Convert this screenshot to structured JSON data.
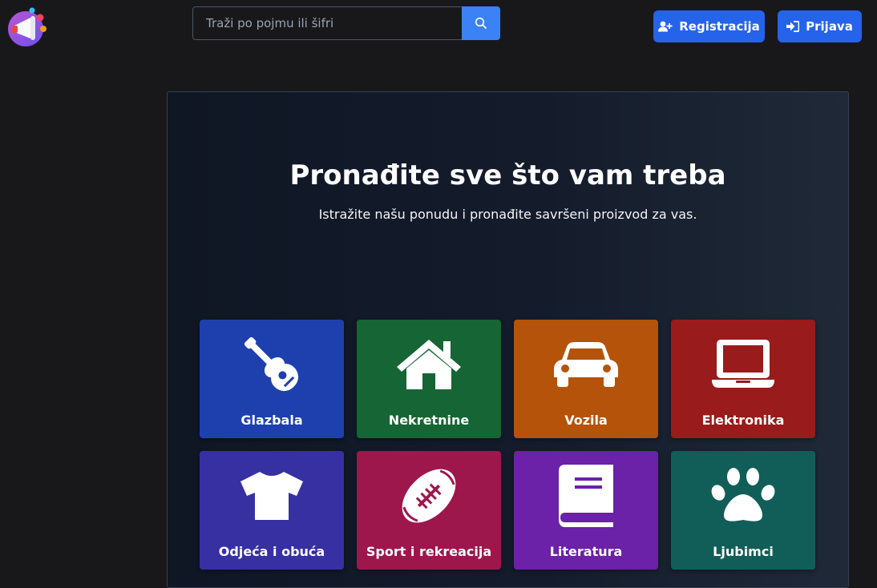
{
  "header": {
    "search": {
      "placeholder": "Traži po pojmu ili šifri",
      "value": ""
    },
    "register_label": "Registracija",
    "login_label": "Prijava"
  },
  "hero": {
    "title": "Pronađite sve što vam treba",
    "subtitle": "Istražite našu ponudu i pronađite savršeni proizvod za vas."
  },
  "categories": [
    {
      "label": "Glazbala",
      "icon": "guitar-icon",
      "color": "#1e40af"
    },
    {
      "label": "Nekretnine",
      "icon": "house-icon",
      "color": "#166534"
    },
    {
      "label": "Vozila",
      "icon": "car-icon",
      "color": "#b45309"
    },
    {
      "label": "Elektronika",
      "icon": "laptop-icon",
      "color": "#991b1b"
    },
    {
      "label": "Odjeća i obuća",
      "icon": "shirt-icon",
      "color": "#3730a3"
    },
    {
      "label": "Sport i rekreacija",
      "icon": "football-icon",
      "color": "#9d174d"
    },
    {
      "label": "Literatura",
      "icon": "book-icon",
      "color": "#6b21a8"
    },
    {
      "label": "Ljubimci",
      "icon": "paw-icon",
      "color": "#115e59"
    }
  ],
  "colors": {
    "accent": "#2563eb",
    "background": "#18181b"
  }
}
